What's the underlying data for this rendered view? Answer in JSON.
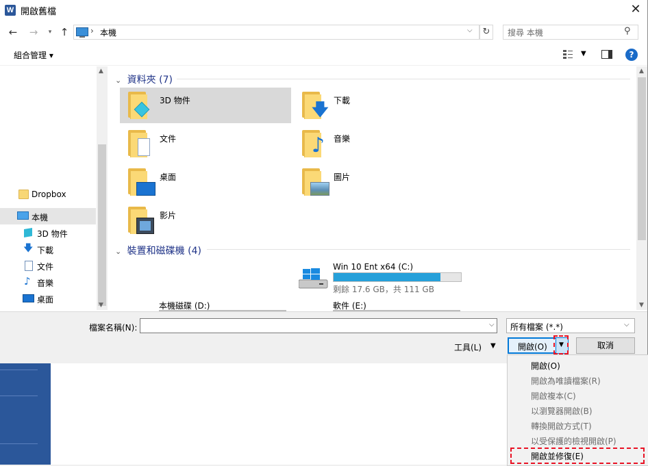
{
  "window": {
    "title": "開啟舊檔",
    "app_badge": "W"
  },
  "address": {
    "location": "本機"
  },
  "search": {
    "placeholder": "搜尋 本機"
  },
  "toolbar": {
    "organize_label": "組合管理 ▾"
  },
  "nav_pane": {
    "items": [
      {
        "label": "Dropbox",
        "icon": "folder-icon"
      },
      {
        "label": "本機",
        "icon": "computer-icon",
        "selected": true
      },
      {
        "label": "3D 物件",
        "icon": "cube-icon"
      },
      {
        "label": "下載",
        "icon": "download-arrow-icon"
      },
      {
        "label": "文件",
        "icon": "document-icon"
      },
      {
        "label": "音樂",
        "icon": "music-note-icon"
      },
      {
        "label": "桌面",
        "icon": "desktop-icon"
      }
    ]
  },
  "folders_group": {
    "header": "資料夾 (7)",
    "items": [
      {
        "label": "3D 物件",
        "icon": "3d-objects-folder-icon",
        "selected": true
      },
      {
        "label": "下載",
        "icon": "downloads-folder-icon"
      },
      {
        "label": "文件",
        "icon": "documents-folder-icon"
      },
      {
        "label": "音樂",
        "icon": "music-folder-icon"
      },
      {
        "label": "桌面",
        "icon": "desktop-folder-icon"
      },
      {
        "label": "圖片",
        "icon": "pictures-folder-icon"
      },
      {
        "label": "影片",
        "icon": "videos-folder-icon"
      }
    ]
  },
  "devices_group": {
    "header": "裝置和磁碟機 (4)",
    "drives": [
      {
        "name": "Win 10 Ent x64 (C:)",
        "free_text": "剩餘 17.6 GB，共 111 GB",
        "used_fraction": 0.84
      },
      {
        "name": "本機磁碟 (D:)"
      },
      {
        "name": "軟件 (E:)"
      }
    ]
  },
  "bottom": {
    "filename_label": "檔案名稱(N):",
    "filename_value": "",
    "filetype_value": "所有檔案 (*.*)",
    "tools_label": "工具(L)",
    "open_label": "開啟(O)",
    "cancel_label": "取消"
  },
  "open_menu": {
    "items": [
      {
        "label": "開啟(O)",
        "enabled": true
      },
      {
        "label": "開啟為唯讀檔案(R)",
        "enabled": false
      },
      {
        "label": "開啟複本(C)",
        "enabled": false
      },
      {
        "label": "以瀏覽器開啟(B)",
        "enabled": false
      },
      {
        "label": "轉換開啟方式(T)",
        "enabled": false
      },
      {
        "label": "以受保護的檢視開啟(P)",
        "enabled": false
      },
      {
        "label": "開啟並修復(E)",
        "enabled": true,
        "highlighted": true
      }
    ]
  },
  "colors": {
    "accent": "#0078d7",
    "highlight_box": "#e81123",
    "word_blue": "#2b579a"
  }
}
